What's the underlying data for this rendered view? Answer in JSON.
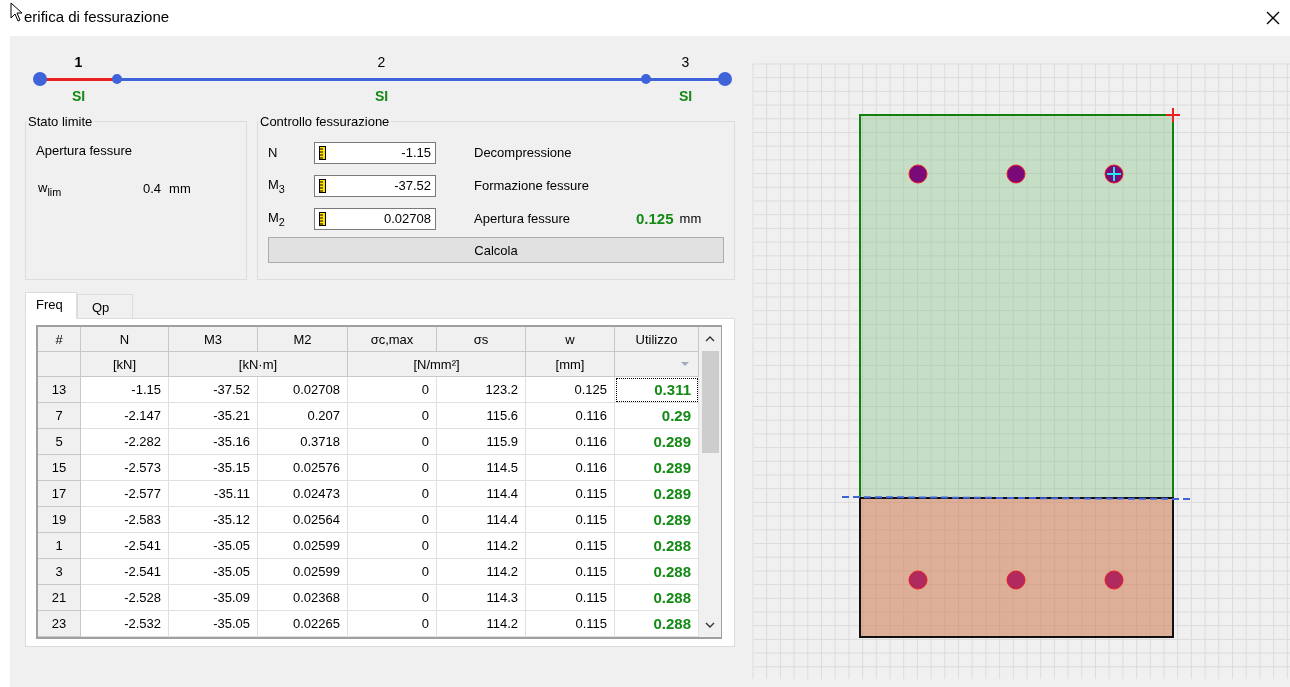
{
  "window": {
    "title": "erifica di fessurazione"
  },
  "steps": [
    {
      "number": "1",
      "status": "SI",
      "selected": true
    },
    {
      "number": "2",
      "status": "SI",
      "selected": false
    },
    {
      "number": "3",
      "status": "SI",
      "selected": false
    }
  ],
  "stato_limite": {
    "title": "Stato limite",
    "type": "Apertura fessure",
    "wlim_label": "w$_{lim}$",
    "wlim_value": "0.4",
    "wlim_unit": "mm"
  },
  "controllo": {
    "title": "Controllo fessurazione",
    "inputs": [
      {
        "label": "N",
        "value": "-1.15"
      },
      {
        "label": "M$_{3}$",
        "value": "-37.52"
      },
      {
        "label": "M$_{2}$",
        "value": "0.02708"
      }
    ],
    "results": [
      {
        "label": "Decompressione"
      },
      {
        "label": "Formazione fessure"
      },
      {
        "label": "Apertura fessure",
        "value": "0.125",
        "unit": "mm"
      }
    ],
    "button": "Calcola"
  },
  "tabs": [
    {
      "label": "Freq",
      "selected": true
    },
    {
      "label": "Qp",
      "selected": false
    }
  ],
  "table": {
    "columns": [
      {
        "label": "#"
      },
      {
        "label": "N",
        "unit": "[kN]"
      },
      {
        "label": "M3",
        "unit": "[kN·m]"
      },
      {
        "label": "M2",
        "unit_merged": true
      },
      {
        "label": "σc,max",
        "unit": "[N/mm²]"
      },
      {
        "label": "σs",
        "unit_merged": true
      },
      {
        "label": "w",
        "unit": "[mm]"
      },
      {
        "label": "Utilizzo",
        "sorted": true
      }
    ],
    "rows": [
      {
        "cells": [
          "13",
          "-1.15",
          "-37.52",
          "0.02708",
          "0",
          "123.2",
          "0.125",
          "0.311"
        ],
        "selected": true
      },
      {
        "cells": [
          "7",
          "-2.147",
          "-35.21",
          "0.207",
          "0",
          "115.6",
          "0.116",
          "0.29"
        ],
        "selected": false
      },
      {
        "cells": [
          "5",
          "-2.282",
          "-35.16",
          "0.3718",
          "0",
          "115.9",
          "0.116",
          "0.289"
        ],
        "selected": false
      },
      {
        "cells": [
          "15",
          "-2.573",
          "-35.15",
          "0.02576",
          "0",
          "114.5",
          "0.116",
          "0.289"
        ],
        "selected": false
      },
      {
        "cells": [
          "17",
          "-2.577",
          "-35.11",
          "0.02473",
          "0",
          "114.4",
          "0.115",
          "0.289"
        ],
        "selected": false
      },
      {
        "cells": [
          "19",
          "-2.583",
          "-35.12",
          "0.02564",
          "0",
          "114.4",
          "0.115",
          "0.289"
        ],
        "selected": false
      },
      {
        "cells": [
          "1",
          "-2.541",
          "-35.05",
          "0.02599",
          "0",
          "114.2",
          "0.115",
          "0.288"
        ],
        "selected": false
      },
      {
        "cells": [
          "3",
          "-2.541",
          "-35.05",
          "0.02599",
          "0",
          "114.2",
          "0.115",
          "0.288"
        ],
        "selected": false
      },
      {
        "cells": [
          "21",
          "-2.528",
          "-35.09",
          "0.02368",
          "0",
          "114.3",
          "0.115",
          "0.288"
        ],
        "selected": false
      },
      {
        "cells": [
          "23",
          "-2.532",
          "-35.05",
          "0.02265",
          "0",
          "114.2",
          "0.115",
          "0.288"
        ],
        "selected": false
      }
    ]
  }
}
